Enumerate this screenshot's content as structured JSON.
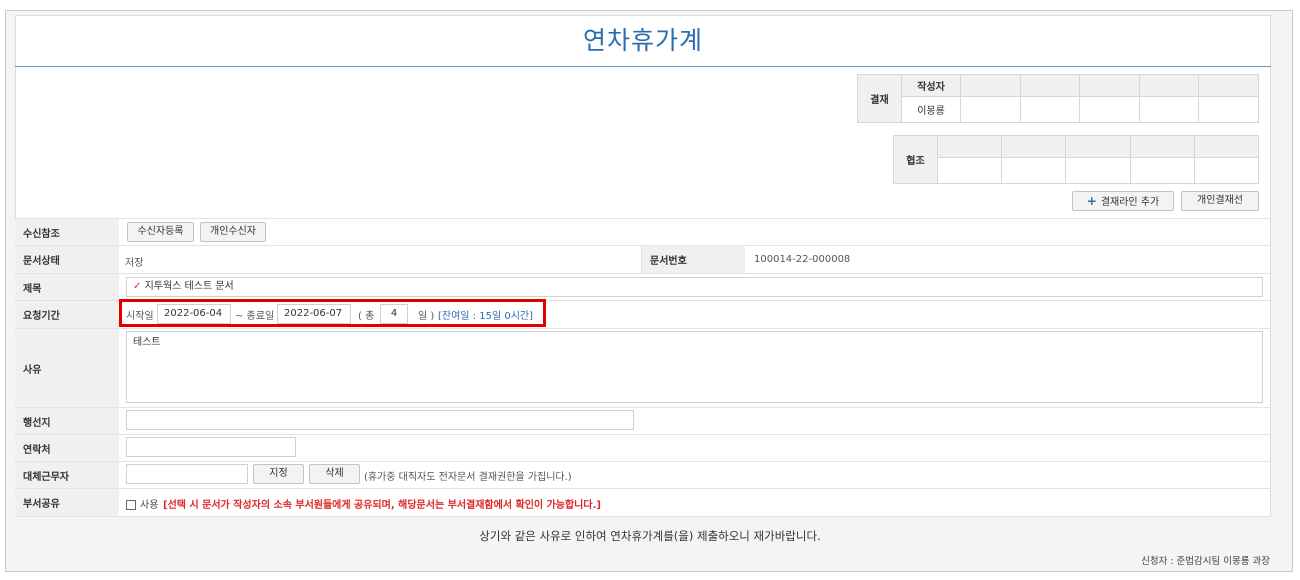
{
  "title": "연차휴가계",
  "approval": {
    "label": "결재",
    "writer_header": "작성자",
    "writer_name": "이몽룡"
  },
  "cooperation": {
    "label": "협조"
  },
  "buttons": {
    "add_approval_line": "결재라인 추가",
    "personal_approval": "개인결재선",
    "register_recipient": "수신자등록",
    "personal_recipient": "개인수신자",
    "assign": "지정",
    "delete": "삭제"
  },
  "fields": {
    "recipient_ref": "수신참조",
    "doc_status": "문서상태",
    "doc_status_value": "저장",
    "doc_number": "문서번호",
    "doc_number_value": "100014-22-000008",
    "subject": "제목",
    "subject_value": "지투웍스 테스트 문서",
    "period": "요청기간",
    "start_label": "시작일",
    "start_date": "2022-06-04",
    "end_label": "~ 종료일",
    "end_date": "2022-06-07",
    "total_open": "( 총",
    "total_days": "4",
    "days_close": "일 )",
    "remaining": "[잔여일 : 15일 0시간]",
    "reason": "사유",
    "reason_value": "테스트",
    "destination": "행선지",
    "contact": "연락처",
    "substitute": "대체근무자",
    "substitute_note": "(휴가중 대직자도 전자문서 결재권한을 가집니다.)",
    "dept_share": "부서공유",
    "use_label": "사용",
    "share_note": "[선택 시 문서가 작성자의 소속 부서원들에게 공유되며, 해당문서는 부서결재함에서 확인이 가능합니다.]"
  },
  "footer": {
    "statement": "상기와 같은 사유로 인하여 연차휴가계를(을) 제출하오니 재가바랍니다.",
    "applicant": "신청자 : 준법감시팀   이몽룡 과장"
  },
  "colors": {
    "accent": "#2a6db0",
    "highlight_border": "#e00000",
    "warning": "#e02828"
  }
}
